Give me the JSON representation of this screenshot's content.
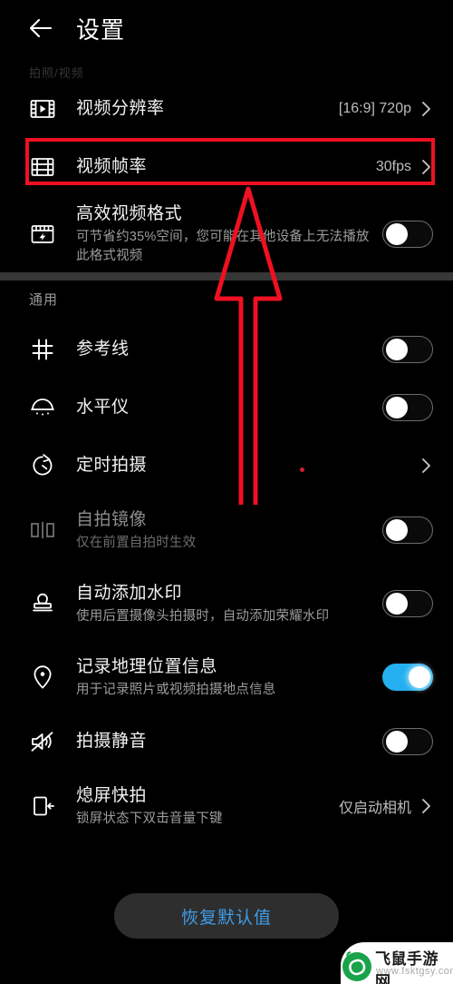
{
  "header": {
    "back_icon": "arrow-left-icon",
    "title": "设置"
  },
  "sections": [
    {
      "label": "拍照/视频",
      "label_faint": true,
      "rows": [
        {
          "icon": "film-play-icon",
          "title": "视频分辨率",
          "sub": "",
          "value": "[16:9] 720p",
          "control": "chevron"
        },
        {
          "icon": "film-strip-icon",
          "title": "视频帧率",
          "sub": "",
          "value": "30fps",
          "control": "chevron",
          "highlighted": true
        },
        {
          "icon": "video-bolt-icon",
          "title": "高效视频格式",
          "sub": "可节省约35%空间，您可能在其他设备上无法播放此格式视频",
          "value": "",
          "control": "toggle",
          "toggle_on": false
        }
      ]
    },
    {
      "label": "通用",
      "label_faint": false,
      "rows": [
        {
          "icon": "grid-lines-icon",
          "title": "参考线",
          "sub": "",
          "value": "",
          "control": "toggle",
          "toggle_on": false
        },
        {
          "icon": "level-meter-icon",
          "title": "水平仪",
          "sub": "",
          "value": "",
          "control": "toggle",
          "toggle_on": false
        },
        {
          "icon": "timer-icon",
          "title": "定时拍摄",
          "sub": "",
          "value": "",
          "control": "chevron"
        },
        {
          "icon": "mirror-icon",
          "title": "自拍镜像",
          "sub": "仅在前置自拍时生效",
          "value": "",
          "control": "toggle",
          "toggle_on": false,
          "dimmed": true
        },
        {
          "icon": "stamp-icon",
          "title": "自动添加水印",
          "sub": "使用后置摄像头拍摄时，自动添加荣耀水印",
          "value": "",
          "control": "toggle",
          "toggle_on": false
        },
        {
          "icon": "location-pin-icon",
          "title": "记录地理位置信息",
          "sub": "用于记录照片或视频拍摄地点信息",
          "value": "",
          "control": "toggle",
          "toggle_on": true
        },
        {
          "icon": "mute-icon",
          "title": "拍摄静音",
          "sub": "",
          "value": "",
          "control": "toggle",
          "toggle_on": false
        },
        {
          "icon": "phone-quickshot-icon",
          "title": "熄屏快拍",
          "sub": "锁屏状态下双击音量下键",
          "value": "仅启动相机",
          "control": "chevron"
        }
      ]
    }
  ],
  "footer": {
    "reset_label": "恢复默认值"
  },
  "annotations": {
    "highlight_target": "视频帧率",
    "arrow_color": "#ee1122",
    "highlight_color": "#ee1122"
  },
  "watermark": {
    "site_name": "飞鼠手游网",
    "url": "www.fsktgsy.com"
  },
  "colors": {
    "background": "#000000",
    "toggle_on": "#24b0f0",
    "accent_link": "#3f9ce8",
    "divider": "#373737",
    "title_text": "#f2f2f2",
    "sub_text": "#9c9c9c",
    "value_text": "#bdbdbd"
  }
}
